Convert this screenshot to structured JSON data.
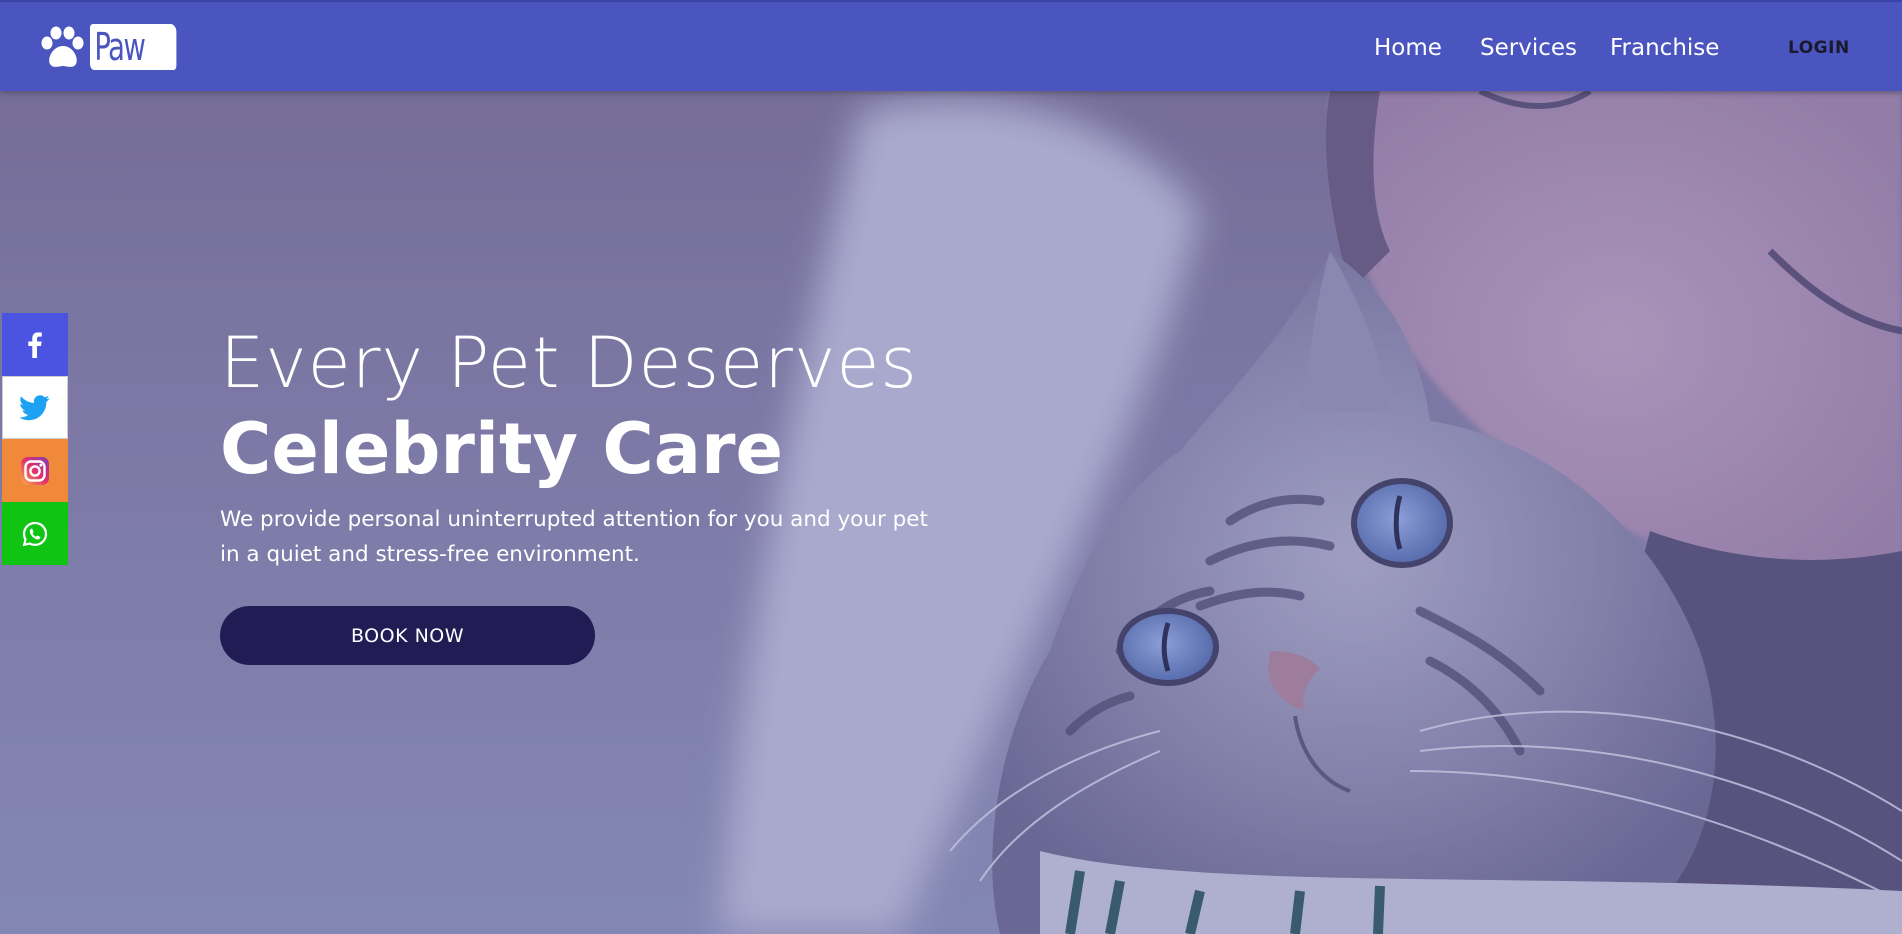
{
  "header": {
    "logo_text": "Paw",
    "nav": {
      "home": "Home",
      "services": "Services",
      "franchise": "Franchise",
      "login": "LOGIN"
    }
  },
  "hero": {
    "title_line1": "Every Pet Deserves",
    "title_line2": "Celebrity Care",
    "subtitle": "We provide personal uninterrupted attention for you and your pet in a quiet and stress-free environment.",
    "cta_label": "BOOK NOW",
    "image": "woman-hugging-tabby-cat"
  },
  "social": [
    {
      "name": "facebook-icon",
      "color": "#4a54e0"
    },
    {
      "name": "twitter-icon",
      "color": "#1da1f2"
    },
    {
      "name": "instagram-icon",
      "color": "#f08a3a"
    },
    {
      "name": "whatsapp-icon",
      "color": "#10c414"
    }
  ],
  "colors": {
    "header": "#4a55c0",
    "button": "#221c55",
    "overlay": "#5f5faa"
  }
}
